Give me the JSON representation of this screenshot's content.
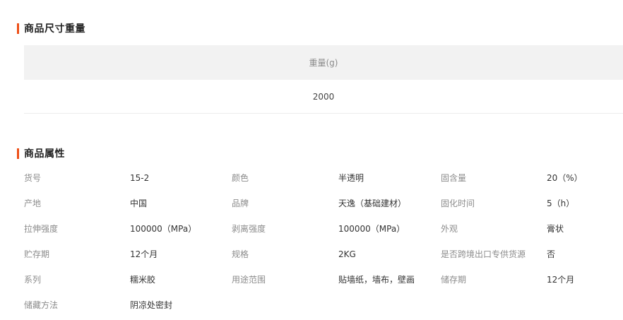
{
  "size_section": {
    "title": "商品尺寸重量",
    "header": "重量(g)",
    "value": "2000"
  },
  "attr_section": {
    "title": "商品属性",
    "rows": [
      [
        {
          "label": "货号",
          "value": "15-2"
        },
        {
          "label": "颜色",
          "value": "半透明"
        },
        {
          "label": "固含量",
          "value": "20（%）"
        }
      ],
      [
        {
          "label": "产地",
          "value": "中国"
        },
        {
          "label": "品牌",
          "value": "天逸（基础建材）"
        },
        {
          "label": "固化时间",
          "value": "5（h）"
        }
      ],
      [
        {
          "label": "拉伸强度",
          "value": "100000（MPa）"
        },
        {
          "label": "剥离强度",
          "value": "100000（MPa）"
        },
        {
          "label": "外观",
          "value": "膏状"
        }
      ],
      [
        {
          "label": "贮存期",
          "value": "12个月"
        },
        {
          "label": "规格",
          "value": "2KG"
        },
        {
          "label": "是否跨境出口专供货源",
          "value": "否"
        }
      ],
      [
        {
          "label": "系列",
          "value": "糯米胶"
        },
        {
          "label": "用途范围",
          "value": "贴墙纸，墙布，壁画"
        },
        {
          "label": "储存期",
          "value": "12个月"
        }
      ],
      [
        {
          "label": "储藏方法",
          "value": "阴凉处密封"
        }
      ]
    ]
  },
  "colors": {
    "accent": "#ee4f17",
    "header_bg": "#f2f2f2",
    "label_text": "#8c8c8c",
    "value_text": "#333333"
  }
}
